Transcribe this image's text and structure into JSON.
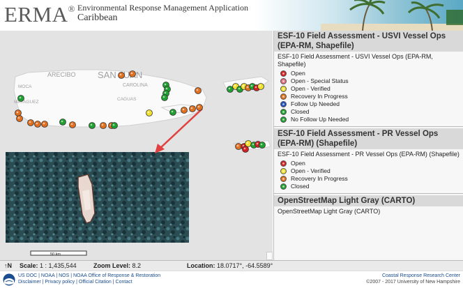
{
  "header": {
    "logo": "ERMA",
    "logo_mark": "®",
    "app_title": "Environmental Response Management Application",
    "app_subtitle": "Caribbean"
  },
  "map": {
    "labels": {
      "arecibo": "ARECIBO",
      "san_juan": "SAN JUAN",
      "carolina": "CAROLINA",
      "moca": "MOCA",
      "mayaguez": "MAYAGUEZ",
      "caguas": "CAGUAS"
    },
    "scalebar_label": "50 km"
  },
  "panel": {
    "groups": [
      {
        "title": "ESF-10 Field Assessment - USVI Vessel Ops (EPA-RM, Shapefile)",
        "subtitle": "ESF-10 Field Assessment - USVI Vessel Ops (EPA-RM, Shapefile)",
        "legend": [
          {
            "label": "Open",
            "color": "#d42020"
          },
          {
            "label": "Open - Special Status",
            "color": "#e07080"
          },
          {
            "label": "Open - Verified",
            "color": "#f0e030"
          },
          {
            "label": "Recovery In Progress",
            "color": "#e07020"
          },
          {
            "label": "Follow Up Needed",
            "color": "#2050c0"
          },
          {
            "label": "Closed",
            "color": "#20a030"
          },
          {
            "label": "No Follow Up Needed",
            "color": "#20a030"
          }
        ]
      },
      {
        "title": "ESF-10 Field Assessment - PR Vessel Ops (EPA-RM) (Shapefile)",
        "subtitle": "ESF-10 Field Assessment - PR Vessel Ops (EPA-RM) (Shapefile)",
        "legend": [
          {
            "label": "Open",
            "color": "#d42020"
          },
          {
            "label": "Open - Verified",
            "color": "#f0e030"
          },
          {
            "label": "Recovery In Progress",
            "color": "#e07020"
          },
          {
            "label": "Closed",
            "color": "#20a030"
          }
        ]
      },
      {
        "title": "OpenStreetMap Light Gray (CARTO)",
        "subtitle": "OpenStreetMap Light Gray (CARTO)",
        "legend": []
      }
    ]
  },
  "status": {
    "north": "↑N",
    "scale_label": "Scale:",
    "scale_value": "1 : 1,435,544",
    "zoom_label": "Zoom Level:",
    "zoom_value": "8.2",
    "location_label": "Location:",
    "location_value": "18.0717°, -64.5589°"
  },
  "footer": {
    "line1": "US DOC | NOAA | NOS | NOAA Office of Response & Restoration",
    "line2": "Disclaimer | Privacy policy | Official Citation | Contact",
    "right1": "Coastal Response Research Center",
    "right2": "©2007 - 2017 University of New Hampshire"
  },
  "colors": {
    "open": "#d42020",
    "verified": "#f0e030",
    "recovery": "#e07020",
    "closed": "#20a030",
    "arrow": "#e04040"
  }
}
